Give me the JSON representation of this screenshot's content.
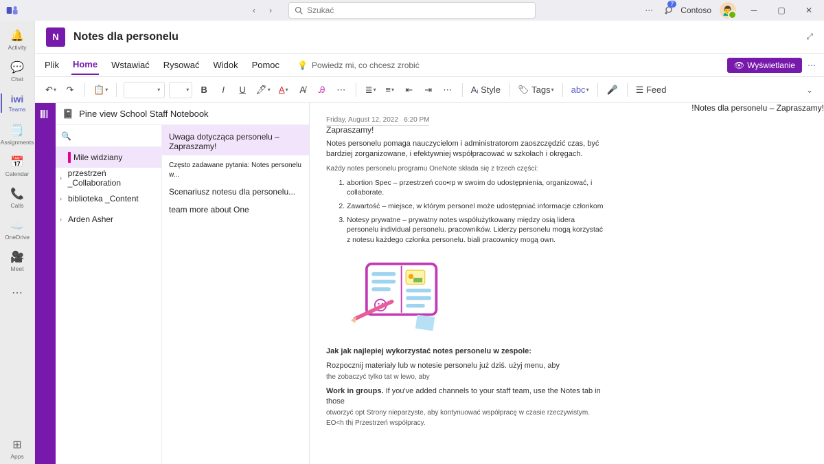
{
  "titlebar": {
    "search_placeholder": "Szukać",
    "org_name": "Contoso",
    "notification_count": "7"
  },
  "rail": {
    "items": [
      {
        "label": "Activity"
      },
      {
        "label": "Chat"
      },
      {
        "label": "iwi",
        "sub": "Teams"
      },
      {
        "label": "Assignments"
      },
      {
        "label": "Calendar"
      },
      {
        "label": "Calls"
      },
      {
        "label": "OneDrive"
      },
      {
        "label": "Meet"
      }
    ],
    "apps_label": "Apps"
  },
  "app_header": {
    "title": "Notes dla personelu"
  },
  "ribbon": {
    "tabs": [
      "Plik",
      "Home",
      "Wstawiać",
      "Rysować",
      "Widok",
      "Pomoc"
    ],
    "active_tab_index": 1,
    "tell_me": "Powiedz mi, co chcesz zrobić",
    "viewing_label": "Wyświetlanie"
  },
  "toolbar": {
    "style_label": "Style",
    "tags_label": "Tags",
    "feed_label": "Feed"
  },
  "notebook": {
    "title": "Pine view School Staff Notebook",
    "sections": [
      {
        "label": "Mile widziany",
        "expandable": false,
        "selected": true
      },
      {
        "label": "przestrzeń _Collaboration",
        "expandable": true
      },
      {
        "label": "biblioteka _Content",
        "expandable": true
      },
      {
        "label": "Arden Asher",
        "expandable": true
      }
    ],
    "pages": [
      {
        "title": "Uwaga dotycząca personelu – Zapraszamy!",
        "selected": true
      },
      {
        "title": "Często zadawane pytania: Notes personelu w...",
        "sub": ""
      },
      {
        "title": "Scenariusz notesu dla personelu..."
      },
      {
        "title": "team more about One"
      }
    ]
  },
  "page": {
    "float_title": "!Notes dla personelu – Zapraszamy!",
    "date": "Friday, August 12, 2022",
    "time": "6:20 PM",
    "welcome_suffix": "Zapraszamy!",
    "intro": "Notes personelu pomaga nauczycielom i administratorom zaoszczędzić czas, być bardziej zorganizowane, i efektywniej współpracować w szkołach i okręgach.",
    "parts_lead": "Każdy notes personelu programu OneNote składa się z trzech części:",
    "parts": [
      "abortion Spec – przestrzeń coo•rp w swoim do udostępnienia, organizować, i collaborate.",
      "Zawartość – miejsce, w którym personel może udostępniać informacje członkom",
      "Notesy prywatne – prywatny notes współużytkowany między osią lidera personelu individual personelu. pracowników. Liderzy personelu mogą korzystać z notesu każdego członka personelu. biali pracownicy mogą own."
    ],
    "best_use": "Jak jak najlepiej wykorzystać notes personelu w zespole:",
    "start": "Rozpocznij materiały lub w notesie personelu już dziś. użyj menu, aby",
    "start_sub": "the zobaczyć tylko tat w lewo, aby",
    "work_groups_lead": "Work in groups.",
    "work_groups_rest": " If you've added channels to your staff team, use the Notes tab in those",
    "work_groups_sub": "otworzyć opt Strony nieparzyste, aby kontynuować współpracę w czasie rzeczywistym. EO<h thị Przestrzeń współpracy."
  }
}
